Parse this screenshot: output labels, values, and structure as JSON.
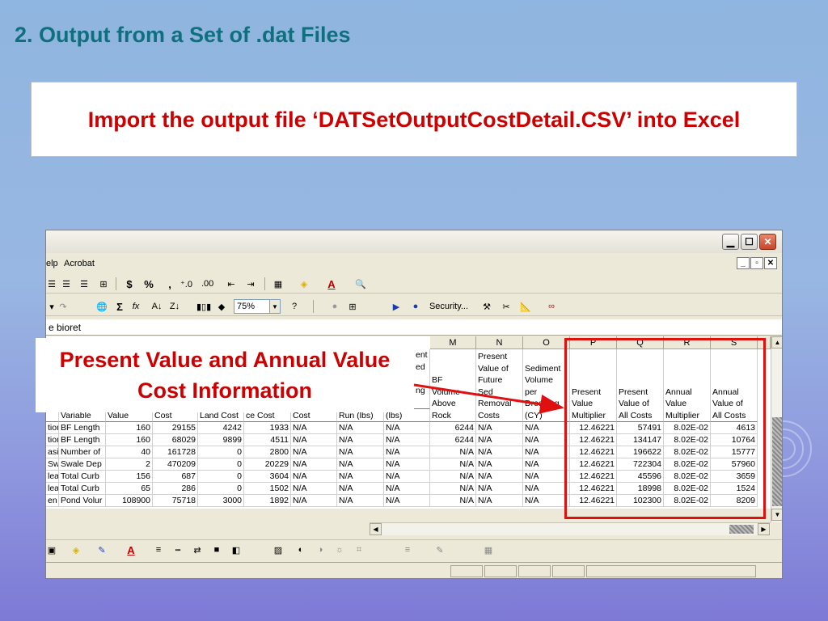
{
  "slide": {
    "title": "2.  Output from a Set of .dat Files",
    "import_instruction": "Import the output file ‘DATSetOutputCostDetail.CSV’ into Excel",
    "callout": "Present Value and Annual Value Cost Information"
  },
  "excel": {
    "menu": {
      "help_partial": "elp",
      "acrobat": "Acrobat"
    },
    "zoom": "75%",
    "security_label": "Security...",
    "formula_text": "e bioret",
    "columns": [
      "M",
      "N",
      "O",
      "P",
      "Q",
      "R",
      "S"
    ],
    "headers_left": {
      "h_a": "ent\ned\n\nng",
      "variable": "Variable",
      "value": "Value",
      "cost": "Cost",
      "land_cost": "Land Cost",
      "maint_cost": "ce Cost",
      "cost2": "Cost",
      "runoff": "Run (lbs)",
      "lbs": "(lbs)"
    },
    "headers_right": {
      "m": "BF\nVolume\nAbove\nRock",
      "n": "Present\nValue of\nFuture\nSed\nRemoval\nCosts",
      "o": "Sediment\nVolume\nper\nDredging\n(CY)",
      "p": "Present\nValue\nMultiplier",
      "q": "Present\nValue of\nAll Costs",
      "r": "Annual\nValue\nMultiplier",
      "s": "Annual\nValue of\nAll Costs"
    },
    "rows": [
      [
        "tion",
        "BF Length",
        "160",
        "29155",
        "4242",
        "1933",
        "N/A",
        "N/A",
        "N/A",
        "6244",
        "N/A",
        "N/A",
        "12.46221",
        "57491",
        "8.02E-02",
        "4613"
      ],
      [
        "tion",
        "BF Length",
        "160",
        "68029",
        "9899",
        "4511",
        "N/A",
        "N/A",
        "N/A",
        "6244",
        "N/A",
        "N/A",
        "12.46221",
        "134147",
        "8.02E-02",
        "10764"
      ],
      [
        "asir",
        "Number of",
        "40",
        "161728",
        "0",
        "2800",
        "N/A",
        "N/A",
        "N/A",
        "N/A",
        "N/A",
        "N/A",
        "12.46221",
        "196622",
        "8.02E-02",
        "15777"
      ],
      [
        "Swa",
        "Swale Dep",
        "2",
        "470209",
        "0",
        "20229",
        "N/A",
        "N/A",
        "N/A",
        "N/A",
        "N/A",
        "N/A",
        "12.46221",
        "722304",
        "8.02E-02",
        "57960"
      ],
      [
        "lea",
        "Total Curb",
        "156",
        "687",
        "0",
        "3604",
        "N/A",
        "N/A",
        "N/A",
        "N/A",
        "N/A",
        "N/A",
        "12.46221",
        "45596",
        "8.02E-02",
        "3659"
      ],
      [
        "lea",
        "Total Curb",
        "65",
        "286",
        "0",
        "1502",
        "N/A",
        "N/A",
        "N/A",
        "N/A",
        "N/A",
        "N/A",
        "12.46221",
        "18998",
        "8.02E-02",
        "1524"
      ],
      [
        "en",
        "Pond Volur",
        "108900",
        "75718",
        "3000",
        "1892",
        "N/A",
        "N/A",
        "N/A",
        "N/A",
        "N/A",
        "N/A",
        "12.46221",
        "102300",
        "8.02E-02",
        "8209"
      ]
    ]
  },
  "colors": {
    "title": "#0f6f7f",
    "callout_text": "#cc0000",
    "highlight_border": "#e01010"
  }
}
